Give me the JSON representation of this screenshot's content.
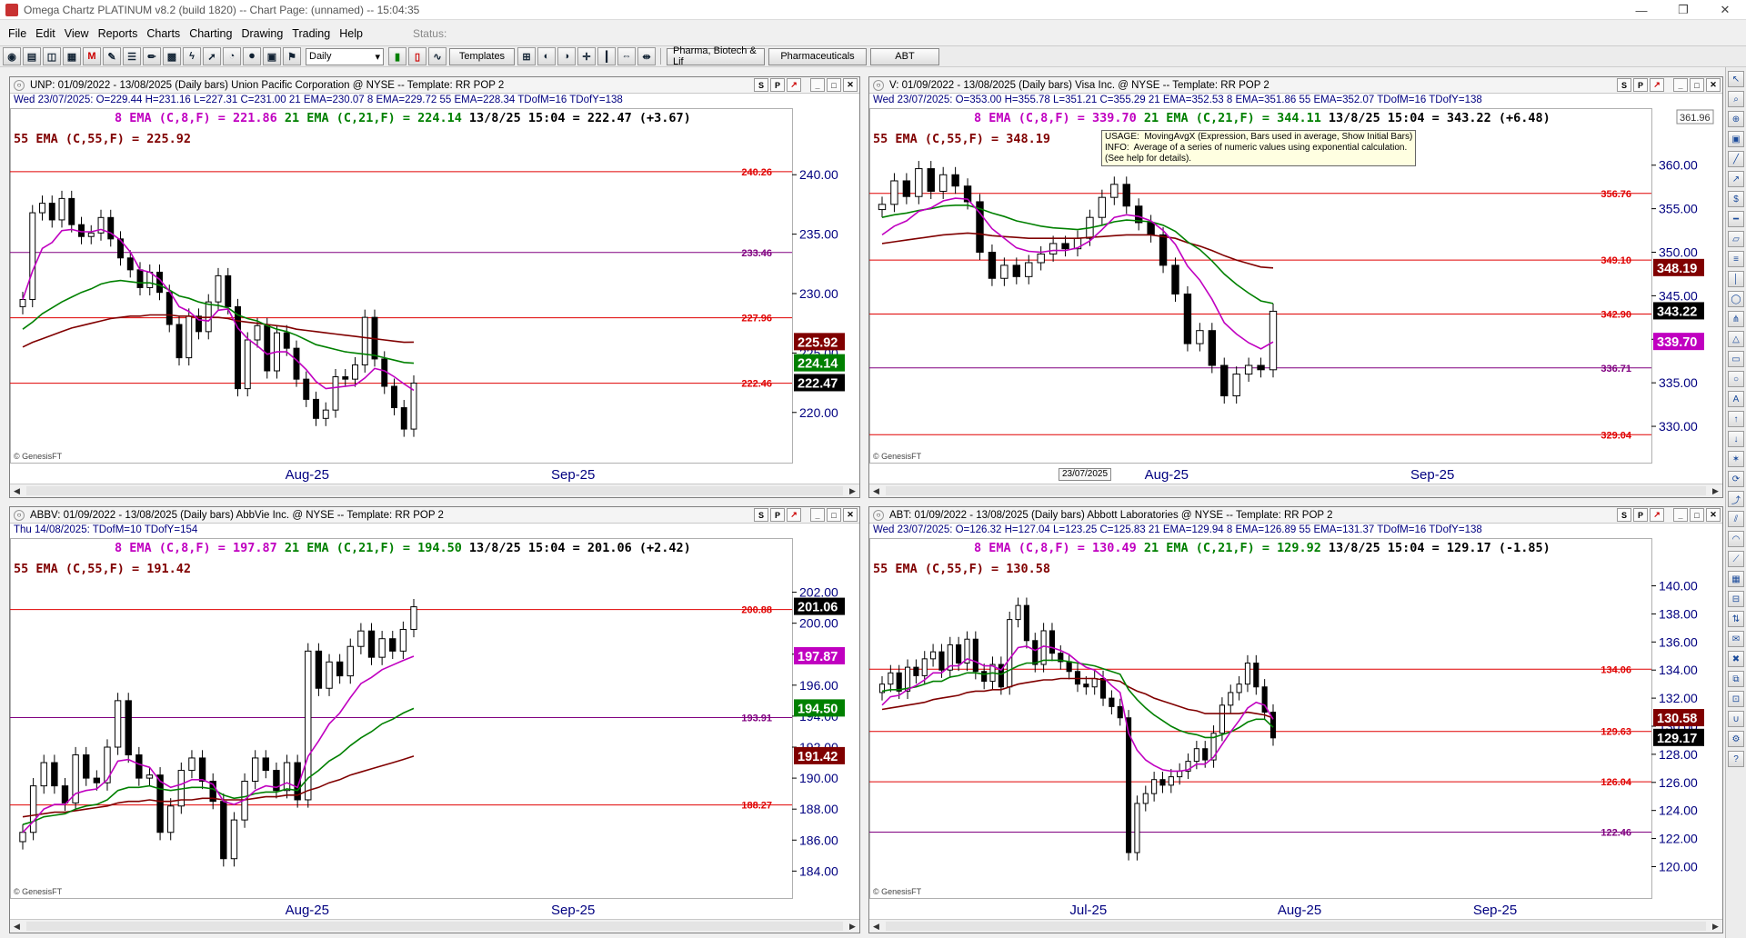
{
  "window": {
    "title": "Omega Chartz PLATINUM v8.2 (build 1820)  --  Chart Page: (unnamed)  --  15:04:35",
    "minimize": "—",
    "restore": "❐",
    "close": "✕"
  },
  "menu": [
    "File",
    "Edit",
    "View",
    "Reports",
    "Charts",
    "Charting",
    "Drawing",
    "Trading",
    "Help"
  ],
  "status_label": "Status:",
  "toolbar": {
    "period": "Daily",
    "templates_label": "Templates",
    "tabs": [
      "Pharma, Biotech & Lif",
      "Pharmaceuticals",
      "ABT"
    ]
  },
  "colors": {
    "ema8": "#c000c0",
    "ema21": "#008000",
    "ema55": "#800000",
    "hline_red": "#e00000",
    "hline_purple": "#800080",
    "info_text": "#000080"
  },
  "panels": [
    {
      "id": "unp",
      "header": "UNP:  01/09/2022 - 13/08/2025  (Daily bars)  Union Pacific Corporation @ NYSE  --  Template: RR POP 2",
      "info_day": "Wed",
      "info_rest": "23/07/2025:  O=229.44  H=231.16  L=227.31  C=231.00  21 EMA=230.07  8 EMA=229.72  55 EMA=228.34  TDofM=16  TDofY=138",
      "ema8_label": "8 EMA (C,8,F) = 221.86",
      "ema21_label": "21 EMA (C,21,F) = 224.14",
      "quote": "13/8/25 15:04 = 222.47 (+3.67)",
      "ema55_label": "55 EMA (C,55,F) = 225.92",
      "ymin": 217.0,
      "ymax": 243.0,
      "axis_ticks": [
        "220.00",
        "225.00",
        "230.00",
        "235.00",
        "240.00"
      ],
      "xlabels": [
        "Aug-25",
        "Sep-25"
      ],
      "hlines": [
        {
          "value": 240.26,
          "label": "240.26",
          "color": "red"
        },
        {
          "value": 233.46,
          "label": "233.46",
          "color": "purple"
        },
        {
          "value": 227.96,
          "label": "227.96",
          "color": "red"
        },
        {
          "value": 222.46,
          "label": "222.46",
          "color": "red"
        }
      ],
      "price_tags": [
        {
          "text": "225.92",
          "value": 225.92,
          "bg": "#800000"
        },
        {
          "text": "224.14",
          "value": 224.14,
          "bg": "#008000"
        },
        {
          "text": "222.47",
          "value": 222.47,
          "bg": "#000000"
        }
      ],
      "watermark": "© GenesisFT",
      "series": {
        "close": [
          229.5,
          236.8,
          237.6,
          236.2,
          238.0,
          235.8,
          234.8,
          235.1,
          236.4,
          234.6,
          233.0,
          232.0,
          230.5,
          231.8,
          230.1,
          227.4,
          224.6,
          228.1,
          226.8,
          229.3,
          231.5,
          228.9,
          222.0,
          226.1,
          227.3,
          223.5,
          226.7,
          225.4,
          222.8,
          221.1,
          219.5,
          220.2,
          223.0,
          222.8,
          224.0,
          228.0,
          224.5,
          222.2,
          220.4,
          218.6,
          222.47
        ],
        "ema8": [
          229.5,
          231.9,
          233.8,
          234.3,
          235.3,
          235.4,
          235.2,
          235.2,
          235.4,
          235.1,
          234.5,
          233.5,
          232.0,
          231.8,
          231.2,
          230.2,
          228.9,
          228.5,
          227.8,
          227.7,
          228.6,
          228.7,
          227.1,
          226.2,
          225.6,
          224.9,
          225.1,
          225.1,
          224.4,
          223.6,
          222.6,
          222.0,
          222.1,
          222.2,
          222.3,
          222.9,
          223.7,
          223.5,
          223.0,
          222.4,
          221.86
        ],
        "ema21": [
          227.0,
          227.6,
          228.3,
          228.8,
          229.3,
          229.7,
          230.1,
          230.4,
          230.8,
          231.0,
          231.1,
          231.0,
          230.9,
          230.9,
          230.7,
          230.3,
          229.8,
          229.6,
          229.3,
          229.1,
          229.0,
          228.8,
          228.2,
          227.9,
          227.7,
          227.3,
          227.0,
          226.8,
          226.5,
          226.1,
          225.7,
          225.5,
          225.3,
          225.1,
          225.0,
          224.9,
          224.8,
          224.6,
          224.4,
          224.2,
          224.14
        ],
        "ema55": [
          225.5,
          225.9,
          226.2,
          226.5,
          226.8,
          227.1,
          227.3,
          227.5,
          227.7,
          227.9,
          228.0,
          228.1,
          228.1,
          228.2,
          228.2,
          228.2,
          228.1,
          228.1,
          228.0,
          228.0,
          228.0,
          227.9,
          227.7,
          227.6,
          227.5,
          227.4,
          227.3,
          227.2,
          227.0,
          226.9,
          226.8,
          226.7,
          226.6,
          226.5,
          226.4,
          226.3,
          226.2,
          226.1,
          226.0,
          225.9,
          225.92
        ]
      }
    },
    {
      "id": "v",
      "header": "V:  01/09/2022 - 13/08/2025  (Daily bars)  Visa Inc. @ NYSE  --  Template: RR POP 2",
      "info_day": "Wed",
      "info_rest": "23/07/2025:  O=353.00  H=355.78  L=351.21  C=355.29  21 EMA=352.53  8 EMA=351.86  55 EMA=352.07  TDofM=16  TDofY=138",
      "ema8_label": "8 EMA (C,8,F) = 339.70",
      "ema21_label": "21 EMA (C,21,F) = 344.11",
      "quote": "13/8/25 15:04 = 343.22 (+6.48)",
      "ema55_label": "55 EMA (C,55,F) = 348.19",
      "ymin": 327.5,
      "ymax": 363.0,
      "axis_ticks": [
        "330.00",
        "335.00",
        "340.00",
        "345.00",
        "350.00",
        "355.00",
        "360.00"
      ],
      "xlabels": [
        "Aug-25",
        "Sep-25"
      ],
      "hlines": [
        {
          "value": 356.76,
          "label": "356.76",
          "color": "red"
        },
        {
          "value": 349.1,
          "label": "349.10",
          "color": "red"
        },
        {
          "value": 342.9,
          "label": "342.90",
          "color": "red"
        },
        {
          "value": 336.71,
          "label": "336.71",
          "color": "purple"
        },
        {
          "value": 329.04,
          "label": "329.04",
          "color": "red"
        }
      ],
      "price_tags": [
        {
          "text": "348.19",
          "value": 348.19,
          "bg": "#800000"
        },
        {
          "text": "343.22",
          "value": 343.22,
          "bg": "#000000"
        },
        {
          "text": "339.70",
          "value": 339.7,
          "bg": "#c000c0"
        }
      ],
      "top_tag": "361.96",
      "tooltip": "USAGE:  MovingAvgX (Expression, Bars used in average, Show Initial Bars)\nINFO:  Average of a series of numeric values using exponential calculation.\n(See help for details).",
      "date_box": "23/07/2025",
      "watermark": "© GenesisFT",
      "series": {
        "close": [
          355.5,
          358.2,
          356.4,
          359.6,
          357.0,
          358.9,
          357.6,
          355.8,
          350.0,
          347.0,
          348.5,
          347.2,
          348.8,
          349.8,
          351.0,
          350.4,
          351.6,
          354.0,
          356.3,
          357.8,
          355.3,
          353.4,
          352.0,
          348.5,
          345.2,
          339.5,
          341.0,
          337.0,
          333.5,
          336.0,
          337.0,
          336.5,
          343.22
        ],
        "ema8": [
          352.0,
          353.0,
          353.6,
          354.7,
          355.1,
          355.9,
          356.2,
          356.1,
          354.5,
          352.7,
          351.6,
          350.5,
          350.1,
          350.0,
          350.2,
          350.2,
          350.5,
          351.3,
          352.6,
          354.0,
          354.3,
          354.1,
          353.6,
          352.5,
          350.9,
          348.4,
          346.8,
          344.6,
          341.9,
          340.6,
          339.6,
          338.9,
          339.7
        ],
        "ema21": [
          354.0,
          354.3,
          354.5,
          354.8,
          355.0,
          355.3,
          355.4,
          355.4,
          355.0,
          354.5,
          354.1,
          353.6,
          353.3,
          353.0,
          352.8,
          352.7,
          352.6,
          352.8,
          353.1,
          353.5,
          353.7,
          353.6,
          353.5,
          353.1,
          352.4,
          351.2,
          350.3,
          349.0,
          347.5,
          346.3,
          345.3,
          344.4,
          344.11
        ],
        "ema55": [
          351.0,
          351.2,
          351.4,
          351.6,
          351.8,
          352.0,
          352.1,
          352.2,
          352.1,
          351.9,
          351.8,
          351.7,
          351.6,
          351.6,
          351.6,
          351.6,
          351.6,
          351.7,
          351.8,
          351.9,
          352.0,
          352.0,
          352.0,
          351.8,
          351.6,
          351.1,
          350.7,
          350.2,
          349.6,
          349.1,
          348.7,
          348.3,
          348.19
        ]
      }
    },
    {
      "id": "abbv",
      "header": "ABBV:  01/09/2022 - 13/08/2025  (Daily bars)  AbbVie Inc. @ NYSE  --  Template: RR POP 2",
      "info_day": "Thu",
      "info_rest": "14/08/2025:  TDofM=10  TDofY=154",
      "ema8_label": "8 EMA (C,8,F) = 197.87",
      "ema21_label": "21 EMA (C,21,F) = 194.50",
      "quote": "13/8/25 15:04 = 201.06 (+2.42)",
      "ema55_label": "55 EMA (C,55,F) = 191.42",
      "ymin": 183.2,
      "ymax": 203.5,
      "axis_ticks": [
        "184.00",
        "186.00",
        "188.00",
        "190.00",
        "192.00",
        "194.00",
        "196.00",
        "198.00",
        "200.00",
        "202.00"
      ],
      "xlabels": [
        "Aug-25",
        "Sep-25"
      ],
      "hlines": [
        {
          "value": 200.88,
          "label": "200.88",
          "color": "red"
        },
        {
          "value": 193.91,
          "label": "193.91",
          "color": "purple"
        },
        {
          "value": 188.27,
          "label": "188.27",
          "color": "red"
        }
      ],
      "price_tags": [
        {
          "text": "201.06",
          "value": 201.06,
          "bg": "#000000"
        },
        {
          "text": "197.87",
          "value": 197.87,
          "bg": "#c000c0"
        },
        {
          "text": "194.50",
          "value": 194.5,
          "bg": "#008000"
        },
        {
          "text": "191.42",
          "value": 191.42,
          "bg": "#800000"
        }
      ],
      "watermark": "© GenesisFT",
      "series": {
        "close": [
          186.5,
          189.5,
          191.0,
          189.5,
          188.4,
          191.5,
          190.0,
          189.7,
          192.0,
          195.0,
          191.5,
          190.0,
          190.2,
          186.5,
          188.2,
          190.5,
          191.3,
          189.8,
          188.5,
          184.8,
          187.3,
          189.8,
          191.3,
          190.5,
          189.2,
          191.0,
          188.6,
          198.2,
          195.8,
          197.5,
          196.6,
          198.5,
          199.5,
          197.8,
          199.0,
          198.2,
          199.6,
          201.06
        ],
        "ema8": [
          186.5,
          187.2,
          188.0,
          188.3,
          188.3,
          189.0,
          189.2,
          189.3,
          189.9,
          191.1,
          191.2,
          190.9,
          190.7,
          189.8,
          189.4,
          189.6,
          189.9,
          189.9,
          189.6,
          188.5,
          188.3,
          188.6,
          189.2,
          189.5,
          189.4,
          189.7,
          189.4,
          191.4,
          192.4,
          193.5,
          194.2,
          195.2,
          196.1,
          196.5,
          197.0,
          197.3,
          197.6,
          197.87
        ],
        "ema21": [
          187.0,
          187.2,
          187.5,
          187.6,
          187.7,
          188.0,
          188.2,
          188.3,
          188.6,
          189.2,
          189.4,
          189.4,
          189.5,
          189.3,
          189.2,
          189.3,
          189.4,
          189.4,
          189.3,
          188.9,
          188.7,
          188.8,
          189.0,
          189.1,
          189.1,
          189.3,
          189.2,
          190.0,
          190.5,
          191.1,
          191.5,
          192.1,
          192.6,
          193.0,
          193.5,
          193.8,
          194.2,
          194.5
        ],
        "ema55": [
          187.5,
          187.6,
          187.7,
          187.8,
          187.8,
          187.9,
          188.0,
          188.1,
          188.2,
          188.4,
          188.5,
          188.5,
          188.6,
          188.5,
          188.5,
          188.6,
          188.6,
          188.7,
          188.7,
          188.6,
          188.6,
          188.6,
          188.7,
          188.8,
          188.8,
          188.9,
          188.9,
          189.2,
          189.4,
          189.7,
          189.9,
          190.2,
          190.4,
          190.6,
          190.8,
          191.0,
          191.2,
          191.42
        ]
      }
    },
    {
      "id": "abt",
      "header": "ABT:  01/09/2022 - 13/08/2025  (Daily bars)  Abbott Laboratories @ NYSE  --  Template: RR POP 2",
      "info_day": "Wed",
      "info_rest": "23/07/2025:  O=126.32  H=127.04  L=123.25  C=125.83  21 EMA=129.94  8 EMA=126.89  55 EMA=131.37  TDofM=16  TDofY=138",
      "ema8_label": "8 EMA (C,8,F) = 130.49",
      "ema21_label": "21 EMA (C,21,F) = 129.92",
      "quote": "13/8/25 15:04 = 129.17 (-1.85)",
      "ema55_label": "55 EMA (C,55,F) = 130.58",
      "ymin": 118.8,
      "ymax": 141.2,
      "axis_ticks": [
        "120.00",
        "122.00",
        "124.00",
        "126.00",
        "128.00",
        "130.00",
        "132.00",
        "134.00",
        "136.00",
        "138.00",
        "140.00"
      ],
      "xlabels": [
        "Jul-25",
        "Aug-25",
        "Sep-25"
      ],
      "hlines": [
        {
          "value": 134.06,
          "label": "134.06",
          "color": "red"
        },
        {
          "value": 129.63,
          "label": "129.63",
          "color": "red"
        },
        {
          "value": 126.04,
          "label": "126.04",
          "color": "red"
        },
        {
          "value": 122.46,
          "label": "122.46",
          "color": "purple"
        }
      ],
      "price_tags": [
        {
          "text": "130.58",
          "value": 130.58,
          "bg": "#800000"
        },
        {
          "text": "129.17",
          "value": 129.17,
          "bg": "#000000"
        }
      ],
      "watermark": "© GenesisFT",
      "series": {
        "close": [
          133.0,
          133.8,
          132.5,
          134.2,
          133.6,
          134.8,
          135.3,
          134.0,
          135.8,
          134.5,
          136.2,
          133.9,
          133.2,
          134.4,
          132.8,
          137.6,
          138.6,
          136.1,
          134.4,
          136.8,
          135.2,
          134.6,
          133.9,
          133.0,
          132.8,
          133.4,
          132.0,
          131.4,
          130.6,
          121.0,
          124.5,
          125.2,
          126.2,
          125.8,
          126.4,
          126.8,
          127.5,
          128.4,
          127.6,
          129.5,
          131.5,
          132.4,
          133.0,
          134.5,
          132.8,
          131.0,
          129.17
        ],
        "ema8": [
          131.5,
          132.1,
          132.2,
          132.6,
          132.9,
          133.3,
          133.8,
          133.8,
          134.3,
          134.3,
          134.8,
          134.6,
          134.3,
          134.3,
          134.0,
          134.8,
          135.6,
          135.7,
          135.4,
          135.7,
          135.6,
          135.4,
          135.1,
          134.6,
          134.2,
          134.0,
          133.5,
          132.9,
          132.4,
          129.5,
          128.3,
          127.6,
          127.2,
          126.9,
          126.8,
          126.8,
          126.9,
          127.3,
          127.3,
          127.8,
          128.7,
          129.6,
          130.4,
          131.3,
          131.7,
          131.5,
          130.49
        ],
        "ema21": [
          132.5,
          132.6,
          132.6,
          132.7,
          132.8,
          133.0,
          133.2,
          133.2,
          133.5,
          133.6,
          133.8,
          133.8,
          133.7,
          133.8,
          133.7,
          134.0,
          134.3,
          134.5,
          134.5,
          134.7,
          134.7,
          134.7,
          134.6,
          134.5,
          134.4,
          134.3,
          134.1,
          133.9,
          133.7,
          132.6,
          131.9,
          131.3,
          130.8,
          130.4,
          130.0,
          129.7,
          129.5,
          129.4,
          129.2,
          129.2,
          129.4,
          129.6,
          129.9,
          130.3,
          130.5,
          130.5,
          129.92
        ],
        "ema55": [
          131.2,
          131.3,
          131.4,
          131.5,
          131.6,
          131.7,
          131.9,
          132.0,
          132.1,
          132.2,
          132.4,
          132.5,
          132.5,
          132.6,
          132.6,
          132.8,
          133.0,
          133.1,
          133.2,
          133.3,
          133.3,
          133.4,
          133.4,
          133.4,
          133.4,
          133.4,
          133.3,
          133.3,
          133.2,
          132.8,
          132.5,
          132.3,
          132.0,
          131.8,
          131.6,
          131.4,
          131.2,
          131.1,
          130.9,
          130.9,
          130.9,
          130.9,
          130.9,
          131.0,
          130.9,
          130.8,
          130.58
        ]
      }
    }
  ]
}
